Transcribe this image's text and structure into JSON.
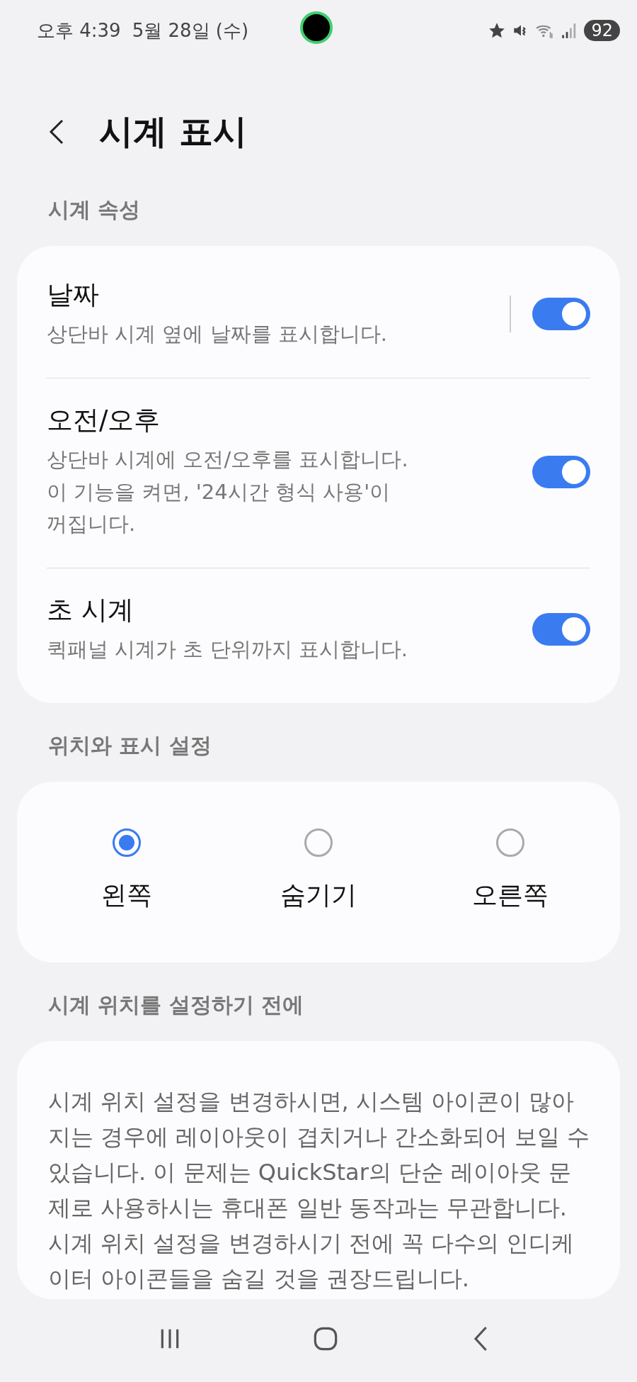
{
  "status_bar": {
    "time": "오후 4:39",
    "date": "5월 28일 (수)",
    "battery": "92"
  },
  "header": {
    "title": "시계 표시"
  },
  "sections": [
    {
      "kind": "toggles",
      "label": "시계 속성",
      "items": [
        {
          "title": "날짜",
          "description": "상단바 시계 옆에 날짜를 표시합니다.",
          "on": true,
          "divider": true
        },
        {
          "title": "오전/오후",
          "description": "상단바 시계에 오전/오후를 표시합니다.\n이 기능을 켜면, '24시간 형식 사용'이\n꺼집니다.",
          "on": true,
          "divider": false
        },
        {
          "title": "초 시계",
          "description": "퀵패널 시계가 초 단위까지 표시합니다.",
          "on": true,
          "divider": false
        }
      ]
    },
    {
      "kind": "radios",
      "label": "위치와 표시 설정",
      "items": [
        {
          "label": "왼쪽",
          "selected": true
        },
        {
          "label": "숨기기",
          "selected": false
        },
        {
          "label": "오른쪽",
          "selected": false
        }
      ]
    },
    {
      "kind": "note",
      "label": "시계 위치를 설정하기 전에",
      "paragraphs": [
        "시계 위치 설정을 변경하시면, 시스템 아이콘이 많아지는 경우에 레이아웃이 겹치거나 간소화되어 보일 수 있습니다. 이 문제는 QuickStar의 단순 레이아웃 문제로 사용하시는 휴대폰 일반 동작과는 무관합니다.",
        "시계 위치 설정을 변경하시기 전에 꼭 다수의 인디케이터 아이콘들을 숨길 것을 권장드립니다."
      ]
    }
  ]
}
